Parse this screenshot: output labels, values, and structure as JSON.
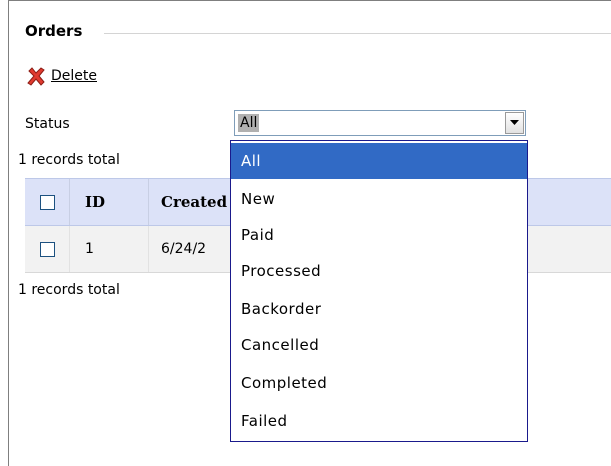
{
  "section": {
    "title": "Orders"
  },
  "toolbar": {
    "delete_label": "Delete",
    "delete_icon": "red-x-icon"
  },
  "filter": {
    "status_label": "Status",
    "selected_value": "All",
    "options": [
      "All",
      "New",
      "Paid",
      "Processed",
      "Backorder",
      "Cancelled",
      "Completed",
      "Failed"
    ]
  },
  "records": {
    "top_text": "1 records total",
    "bottom_text": "1 records total"
  },
  "grid": {
    "columns": [
      "ID",
      "Created"
    ],
    "rows": [
      {
        "id": "1",
        "created": "6/24/2"
      }
    ]
  },
  "colors": {
    "selection": "#316ac5",
    "header_bg": "#dce2f8",
    "delete_icon": "#e03a2f"
  }
}
